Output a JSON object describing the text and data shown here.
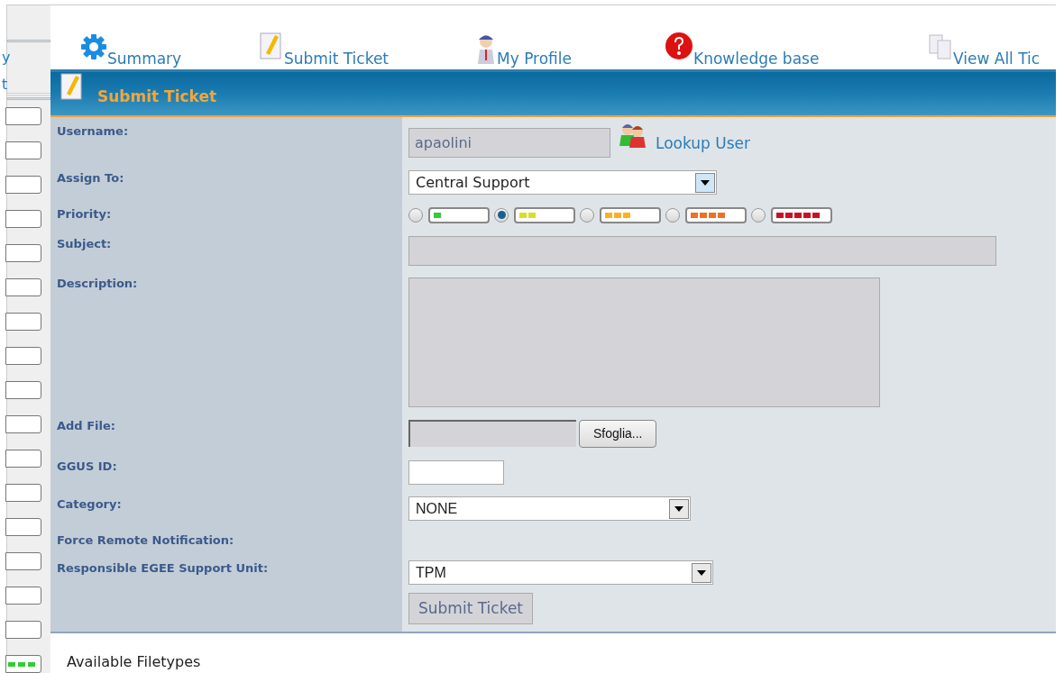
{
  "sidebar": {
    "items": [
      "y",
      "t"
    ]
  },
  "nav": [
    {
      "label": "Summary"
    },
    {
      "label": "Submit Ticket"
    },
    {
      "label": "My Profile"
    },
    {
      "label": "Knowledge base"
    },
    {
      "label": "View All Tic"
    }
  ],
  "panel": {
    "title": "Submit Ticket"
  },
  "form": {
    "username": {
      "label": "Username:",
      "value": "apaolini",
      "lookup": "Lookup User"
    },
    "assign_to": {
      "label": "Assign To:",
      "value": "Central Support"
    },
    "priority": {
      "label": "Priority:",
      "options": [
        {
          "selected": false,
          "color": "#33cc33"
        },
        {
          "selected": true,
          "color": "#dddd22"
        },
        {
          "selected": false,
          "color": "#ffb020"
        },
        {
          "selected": false,
          "color": "#f07020"
        },
        {
          "selected": false,
          "color": "#cc1122"
        }
      ]
    },
    "subject": {
      "label": "Subject:"
    },
    "description": {
      "label": "Description:"
    },
    "add_file": {
      "label": "Add File:",
      "button": "Sfoglia..."
    },
    "ggus_id": {
      "label": "GGUS ID:"
    },
    "category": {
      "label": "Category:",
      "value": "NONE"
    },
    "force_remote_notification": {
      "label": "Force Remote Notification:"
    },
    "support_unit": {
      "label": "Responsible EGEE Support Unit:",
      "value": "TPM"
    },
    "submit": "Submit Ticket"
  },
  "below": {
    "heading": "Available Filetypes"
  }
}
